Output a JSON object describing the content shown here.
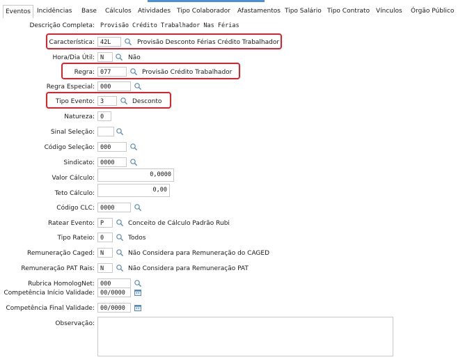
{
  "tabs": [
    {
      "label": "Eventos"
    },
    {
      "label": "Incidências"
    },
    {
      "label": "Base"
    },
    {
      "label": "Cálculos"
    },
    {
      "label": "Atividades"
    },
    {
      "label": "Tipo Colaborador"
    },
    {
      "label": "Afastamentos"
    },
    {
      "label": "Tipo Salário"
    },
    {
      "label": "Tipo Contrato"
    },
    {
      "label": "Vínculos"
    },
    {
      "label": "Órgão Público"
    }
  ],
  "form": {
    "descricao_completa": {
      "label": "Descrição Completa:",
      "value": "Provisão Crédito Trabalhador Nas Férias"
    },
    "caracteristica": {
      "label": "Característica:",
      "value": "42L",
      "desc": "Provisão Desconto Férias Crédito Trabalhador"
    },
    "hora_dia_util": {
      "label": "Hora/Dia Útil:",
      "value": "N",
      "desc": "Não"
    },
    "regra": {
      "label": "Regra:",
      "value": "077",
      "desc": "Provisão Crédito Trabalhador"
    },
    "regra_especial": {
      "label": "Regra Especial:",
      "value": "000"
    },
    "tipo_evento": {
      "label": "Tipo Evento:",
      "value": "3",
      "desc": "Desconto"
    },
    "natureza": {
      "label": "Natureza:",
      "value": "0"
    },
    "sinal_selecao": {
      "label": "Sinal Seleção:",
      "value": ""
    },
    "codigo_selecao": {
      "label": "Código Seleção:",
      "value": "000"
    },
    "sindicato": {
      "label": "Sindicato:",
      "value": "0000"
    },
    "valor_calculo": {
      "label": "Valor Cálculo:",
      "value": "0,0000"
    },
    "teto_calculo": {
      "label": "Teto Cálculo:",
      "value": "0,00"
    },
    "codigo_clc": {
      "label": "Código CLC:",
      "value": "0000"
    },
    "ratear_evento": {
      "label": "Ratear Evento:",
      "value": "P",
      "desc": "Conceito de Cálculo Padrão Rubi"
    },
    "tipo_rateio": {
      "label": "Tipo Rateio:",
      "value": "0",
      "desc": "Todos"
    },
    "remuneracao_caged": {
      "label": "Remuneração Caged:",
      "value": "N",
      "desc": "Não Considera para Remuneração do CAGED"
    },
    "remuneracao_pat_rais": {
      "label": "Remuneração PAT Rais:",
      "value": "N",
      "desc": "Não Considera para Remuneração PAT"
    },
    "rubrica_homolognet": {
      "label": "Rubrica HomologNet:",
      "value": "000"
    },
    "competencia_inicio": {
      "label": "Competência Início Validade:",
      "value": "00/0000"
    },
    "competencia_final": {
      "label": "Competência Final Validade:",
      "value": "00/0000"
    },
    "observacao": {
      "label": "Observação:",
      "value": ""
    }
  },
  "colors": {
    "highlight": "#e0202c",
    "border": "#c8c8c8",
    "accent": "#4a90d9"
  },
  "icons": {
    "lookup": "search-icon",
    "calendar": "calendar-icon"
  }
}
